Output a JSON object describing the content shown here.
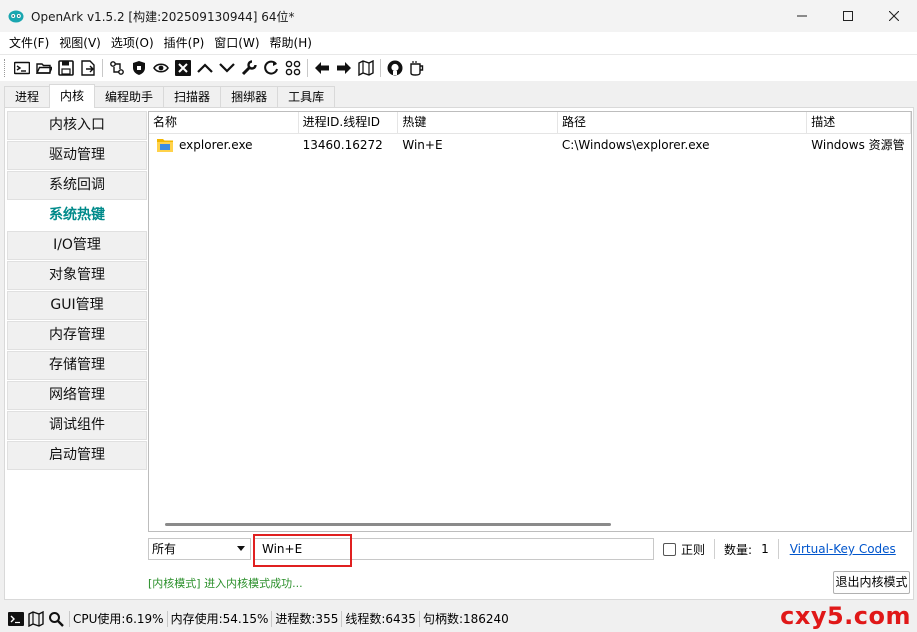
{
  "window": {
    "title": "OpenArk v1.5.2 [构建:202509130944]  64位*"
  },
  "menu": [
    "文件(F)",
    "视图(V)",
    "选项(O)",
    "插件(P)",
    "窗口(W)",
    "帮助(H)"
  ],
  "toolbar": {
    "icons": [
      "console-icon",
      "open-folder-icon",
      "save-icon",
      "export-icon",
      "refresh-link-icon",
      "shield-icon",
      "eye-icon",
      "close-box-icon",
      "arrow-up-icon",
      "arrow-down-icon",
      "wrench-icon",
      "reload-icon",
      "grid-icon",
      "arrow-left-icon",
      "arrow-right-icon",
      "map-icon",
      "github-icon",
      "coffee-icon"
    ]
  },
  "tabs": [
    "进程",
    "内核",
    "编程助手",
    "扫描器",
    "捆绑器",
    "工具库"
  ],
  "active_tab": "内核",
  "sidebar": {
    "items": [
      "内核入口",
      "驱动管理",
      "系统回调",
      "系统热键",
      "I/O管理",
      "对象管理",
      "GUI管理",
      "内存管理",
      "存储管理",
      "网络管理",
      "调试组件",
      "启动管理"
    ],
    "active": "系统热键"
  },
  "table": {
    "columns": [
      "名称",
      "进程ID.线程ID",
      "热键",
      "路径",
      "描述"
    ],
    "rows": [
      {
        "name": "explorer.exe",
        "pid_tid": "13460.16272",
        "hotkey": "Win+E",
        "path": "C:\\Windows\\explorer.exe",
        "desc": "Windows 资源管"
      }
    ]
  },
  "filter": {
    "scope": "所有",
    "search_value": "Win+E",
    "regex_label": "正则",
    "count_label": "数量:",
    "count_value": "1",
    "vk_link": "Virtual-Key Codes"
  },
  "status_message": "[内核模式] 进入内核模式成功...",
  "exit_button": "退出内核模式",
  "statusbar": {
    "cpu": "CPU使用:6.19%",
    "mem": "内存使用:54.15%",
    "procs": "进程数:355",
    "threads": "线程数:6435",
    "handles": "句柄数:186240"
  },
  "watermark": "cxy5.com",
  "colors": {
    "active_nav_text": "#008a8a",
    "highlight_border": "#e02020",
    "status_green": "#2a8f2a",
    "link_blue": "#0055cc",
    "watermark_red": "#e01818"
  }
}
